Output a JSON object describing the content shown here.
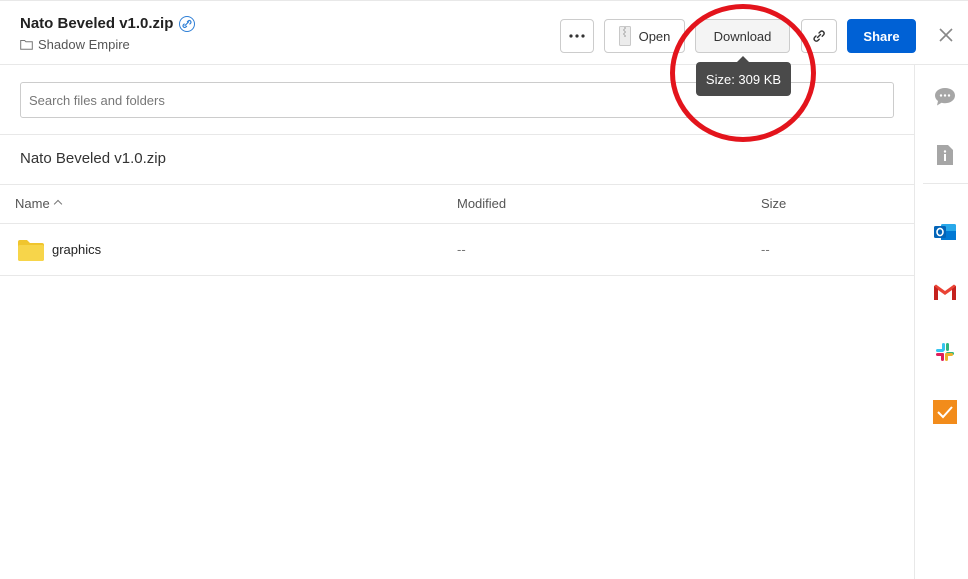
{
  "header": {
    "file_name": "Nato Beveled v1.0.zip",
    "parent_folder": "Shadow Empire"
  },
  "toolbar": {
    "open_label": "Open",
    "download_label": "Download",
    "share_label": "Share",
    "download_tooltip": "Size: 309 KB"
  },
  "search": {
    "placeholder": "Search files and folders"
  },
  "archive": {
    "path_label": "Nato Beveled v1.0.zip",
    "columns": {
      "name": "Name",
      "modified": "Modified",
      "size": "Size"
    },
    "rows": [
      {
        "name": "graphics",
        "modified": "--",
        "size": "--"
      }
    ]
  },
  "sidebar": {
    "icons": [
      "comments-icon",
      "file-info-icon",
      "outlook-icon",
      "gmail-icon",
      "slack-icon",
      "tasks-icon"
    ]
  },
  "colors": {
    "accent": "#0061d5",
    "annotation": "#e3141c",
    "folder": "#f7d54a"
  }
}
